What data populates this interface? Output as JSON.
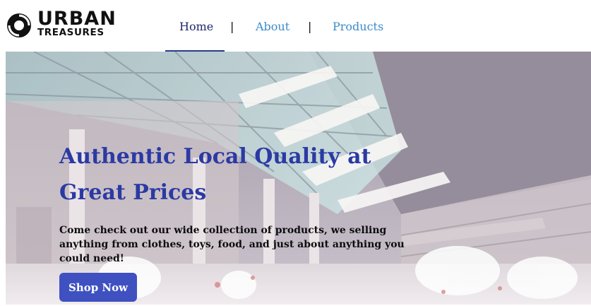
{
  "brand": {
    "word1": "URBAN",
    "word2": "TREASURES",
    "icon": "logo-mark-icon"
  },
  "nav": {
    "items": [
      {
        "label": "Home",
        "active": true
      },
      {
        "label": "About",
        "active": false
      },
      {
        "label": "Products",
        "active": false
      }
    ],
    "separator": "|"
  },
  "hero": {
    "title": "Authentic Local Quality at Great Prices",
    "text": "Come check out our wide collection of products, we selling anything from clothes, toys, food, and just about anything you could need!",
    "button_label": "Shop Now",
    "background": "shopping-mall-photo"
  },
  "colors": {
    "nav_active": "#1f2a6b",
    "nav_link": "#3a8bc9",
    "title": "#2b3aa3",
    "button": "#3f51c0"
  }
}
